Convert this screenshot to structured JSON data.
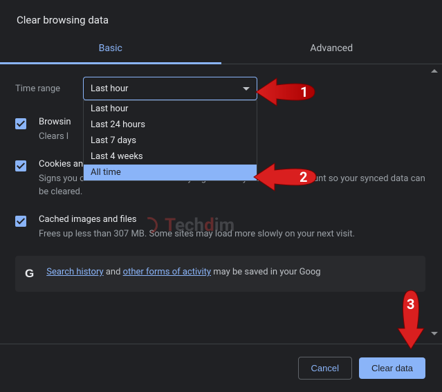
{
  "title": "Clear browsing data",
  "tabs": {
    "basic": "Basic",
    "advanced": "Advanced"
  },
  "time": {
    "label": "Time range",
    "selected": "Last hour",
    "options": [
      "Last hour",
      "Last 24 hours",
      "Last 7 days",
      "Last 4 weeks",
      "All time"
    ],
    "highlighted_index": 4
  },
  "items": {
    "history": {
      "head": "Browsin",
      "desc": "Clears l"
    },
    "cookies": {
      "head": "Cookies and other site data",
      "desc": "Signs you out of most sites. You'll stay signed in to your Google Account so your synced data can be cleared."
    },
    "cache": {
      "head": "Cached images and files",
      "desc": "Frees up less than 307 MB. Some sites may load more slowly on your next visit."
    }
  },
  "notice": {
    "text1": "Search history",
    "text2": " and ",
    "text3": "other forms of activity",
    "text4": " may be saved in your Goog"
  },
  "buttons": {
    "cancel": "Cancel",
    "clear": "Clear data"
  },
  "watermark": {
    "brand": "Techdim"
  },
  "annotations": {
    "a1": "1",
    "a2": "2",
    "a3": "3"
  }
}
